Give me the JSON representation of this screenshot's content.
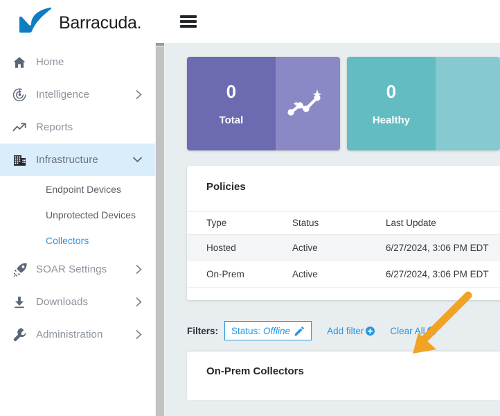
{
  "brand": {
    "name": "Barracuda.",
    "logo_icon": "barracuda-fin-logo",
    "fin_color": "#0f7dc2",
    "wordmark_color": "#1d1d1f"
  },
  "colors": {
    "accent_blue": "#2196e3",
    "sidebar_active_bg": "#d9edfb",
    "card_purple_dark": "#6c6ab0",
    "card_purple_light": "#8b88c6",
    "card_teal_dark": "#62bcc2",
    "card_teal_light": "#86c9d0",
    "page_bg": "#e8edef",
    "annotation_arrow": "#f0a325"
  },
  "topbar": {
    "menu_icon": "hamburger-menu-icon",
    "menu_label": "Menu"
  },
  "sidebar": {
    "items": [
      {
        "label": "Home",
        "icon": "home-icon",
        "has_chevron": false,
        "active": false
      },
      {
        "label": "Intelligence",
        "icon": "radar-target-icon",
        "has_chevron": true,
        "chevron": "chevron-right-icon",
        "active": false
      },
      {
        "label": "Reports",
        "icon": "trend-up-icon",
        "has_chevron": false,
        "active": false
      },
      {
        "label": "Infrastructure",
        "icon": "building-icon",
        "has_chevron": true,
        "chevron": "chevron-down-icon",
        "active": true
      },
      {
        "label": "SOAR Settings",
        "icon": "rocket-icon",
        "has_chevron": true,
        "chevron": "chevron-right-icon",
        "active": false
      },
      {
        "label": "Downloads",
        "icon": "download-icon",
        "has_chevron": true,
        "chevron": "chevron-right-icon",
        "active": false
      },
      {
        "label": "Administration",
        "icon": "wrench-icon",
        "has_chevron": true,
        "chevron": "chevron-right-icon",
        "active": false
      }
    ],
    "subitems": [
      {
        "label": "Endpoint Devices",
        "selected": false
      },
      {
        "label": "Unprotected Devices",
        "selected": false
      },
      {
        "label": "Collectors",
        "selected": true
      }
    ]
  },
  "stats": [
    {
      "value": "0",
      "label": "Total",
      "icon": "sparkline-chart-icon",
      "main_color": "#6c6ab0",
      "side_color": "#8b88c6"
    },
    {
      "value": "0",
      "label": "Healthy",
      "icon": "sparkline-chart-icon",
      "main_color": "#62bcc2",
      "side_color": "#86c9d0"
    }
  ],
  "policies": {
    "title": "Policies",
    "columns": [
      "Type",
      "Status",
      "Last Update"
    ],
    "rows": [
      {
        "type": "Hosted",
        "status": "Active",
        "last_update": "6/27/2024, 3:06 PM EDT"
      },
      {
        "type": "On-Prem",
        "status": "Active",
        "last_update": "6/27/2024, 3:06 PM EDT"
      }
    ]
  },
  "filters": {
    "label": "Filters:",
    "chip": {
      "key": "Status:",
      "value": "Offline",
      "edit_icon": "pencil-icon"
    },
    "add_filter": {
      "label": "Add filter",
      "icon": "plus-circle-icon"
    },
    "clear_all": {
      "label": "Clear All",
      "icon": "minus-circle-icon"
    }
  },
  "bottom_section": {
    "title": "On-Prem Collectors"
  },
  "annotation": {
    "type": "arrow",
    "points_to": "Clear All",
    "color": "#f0a325"
  }
}
